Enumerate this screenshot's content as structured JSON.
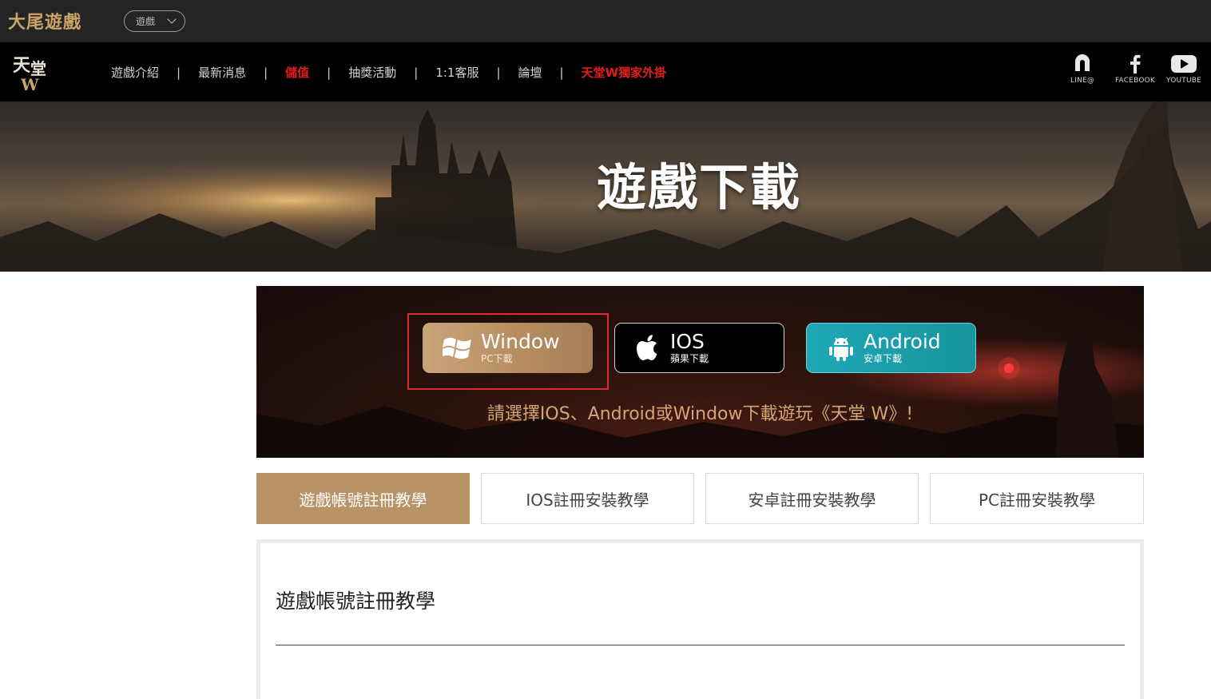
{
  "topbar": {
    "brand": "大尾遊戲",
    "game_select": "遊戲"
  },
  "nav": {
    "logo_alt": "天堂W",
    "items": [
      {
        "label": "遊戲介紹",
        "hot": false
      },
      {
        "label": "最新消息",
        "hot": false
      },
      {
        "label": "儲值",
        "hot": true
      },
      {
        "label": "抽獎活動",
        "hot": false
      },
      {
        "label": "1:1客服",
        "hot": false
      },
      {
        "label": "論壇",
        "hot": false
      },
      {
        "label": "天堂W獨家外掛",
        "hot": true
      }
    ],
    "separator": "|",
    "social": [
      {
        "label": "LINE@",
        "icon": "line-icon"
      },
      {
        "label": "FACEBOOK",
        "icon": "facebook-icon"
      },
      {
        "label": "YOUTUBE",
        "icon": "youtube-icon"
      }
    ]
  },
  "hero": {
    "title": "遊戲下載"
  },
  "download": {
    "buttons": [
      {
        "title": "Window",
        "subtitle": "PC下載",
        "icon": "windows-icon"
      },
      {
        "title": "IOS",
        "subtitle": "蘋果下載",
        "icon": "apple-icon"
      },
      {
        "title": "Android",
        "subtitle": "安卓下載",
        "icon": "android-icon"
      }
    ],
    "note": "請選擇IOS、Android或Window下載遊玩《天堂 W》!"
  },
  "tabs": [
    {
      "label": "遊戲帳號註冊教學",
      "active": true
    },
    {
      "label": "IOS註冊安裝教學",
      "active": false
    },
    {
      "label": "安卓註冊安裝教學",
      "active": false
    },
    {
      "label": "PC註冊安裝教學",
      "active": false
    }
  ],
  "panel": {
    "title": "遊戲帳號註冊教學"
  },
  "colors": {
    "accent_gold": "#b89366",
    "hot_red": "#e41b1b",
    "highlight_red": "#e0282c",
    "android_teal": "#17949f"
  }
}
